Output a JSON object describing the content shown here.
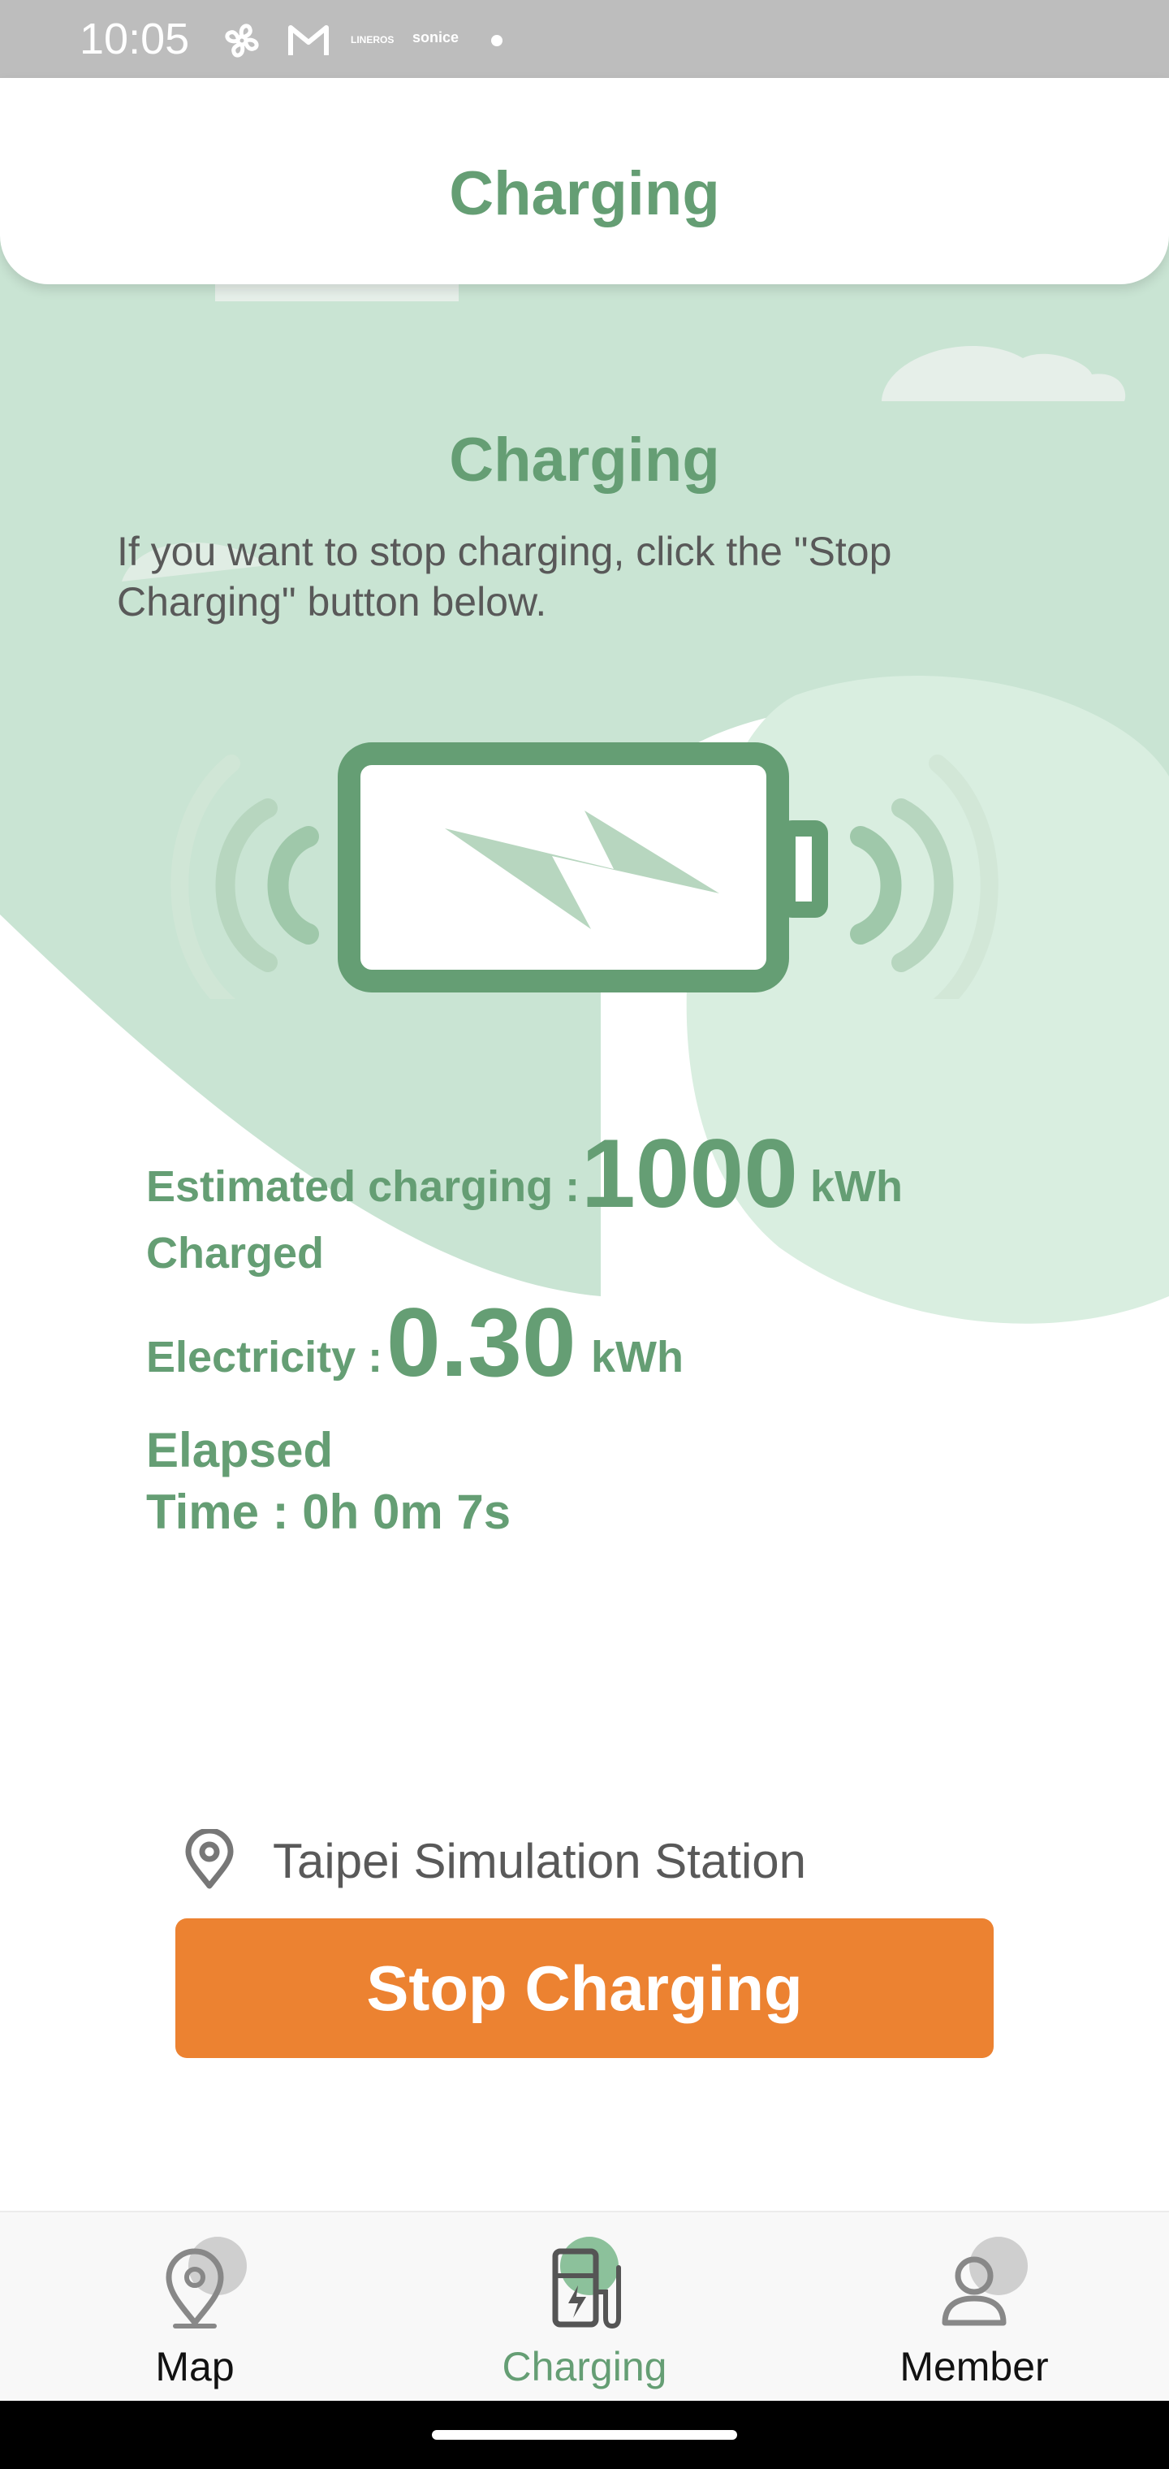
{
  "status_bar": {
    "time": "10:05",
    "icons": [
      "fan-icon",
      "gmail-icon",
      "lineros-text",
      "sonice-text",
      "dot-icon"
    ],
    "lineros": "LINEROS",
    "sonice": "sonice"
  },
  "header": {
    "title": "Charging"
  },
  "main": {
    "title": "Charging",
    "instruction": "If you want to stop charging, click the \"Stop Charging\" button below.",
    "estimated_label": "Estimated charging :",
    "estimated_value": "1000",
    "estimated_unit": "kWh",
    "charged_label": "Charged",
    "electricity_label": "Electricity :",
    "electricity_value": "0.30",
    "electricity_unit": "kWh",
    "elapsed_label": "Elapsed",
    "elapsed_value": "Time : 0h 0m 7s",
    "station": "Taipei Simulation Station",
    "stop_button": "Stop Charging"
  },
  "tabs": [
    {
      "label": "Map",
      "icon": "map-pin-icon",
      "active": false
    },
    {
      "label": "Charging",
      "icon": "charging-station-icon",
      "active": true
    },
    {
      "label": "Member",
      "icon": "member-icon",
      "active": false
    }
  ],
  "colors": {
    "accent": "#659e74",
    "button": "#ec8231",
    "background_green": "#c9e4d3",
    "text_gray": "#595959"
  }
}
